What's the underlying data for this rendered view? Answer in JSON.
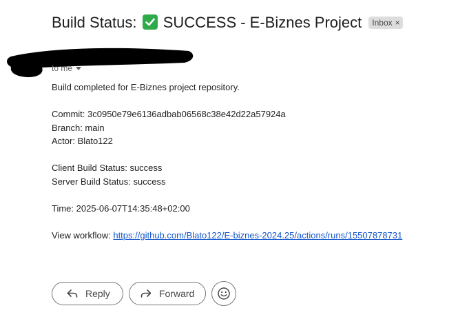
{
  "email": {
    "subject_prefix": "Build Status: ",
    "subject_check_icon": "check-mark-icon",
    "subject_suffix": " SUCCESS - E-Biznes Project",
    "label": "Inbox",
    "label_close": "×",
    "recipient": "to me"
  },
  "body": {
    "intro": "Build completed for E-Biznes project repository.",
    "commit": "Commit: 3c0950e79e6136adbab06568c38e42d22a57924a",
    "branch": "Branch: main",
    "actor": "Actor: Blato122",
    "client_status": "Client Build Status: success",
    "server_status": "Server Build Status: success",
    "time": "Time: 2025-06-07T14:35:48+02:00",
    "workflow_label": "View workflow: ",
    "workflow_url": "https://github.com/Blato122/E-biznes-2024.25/actions/runs/15507878731"
  },
  "actions": {
    "reply": "Reply",
    "forward": "Forward"
  },
  "colors": {
    "accent_link": "#1155cc",
    "check_green": "#2eaa4a",
    "chip_bg": "#dddddd"
  }
}
